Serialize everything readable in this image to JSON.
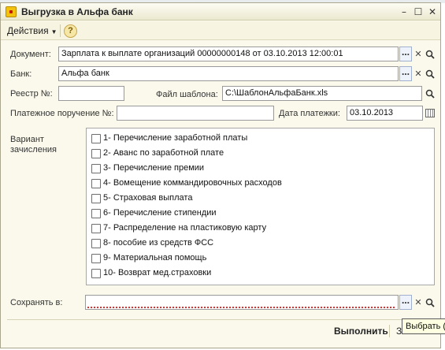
{
  "window": {
    "title": "Выгрузка в Альфа банк",
    "controls": {
      "minimize": "–",
      "maximize": "☐",
      "close": "✕"
    }
  },
  "toolbar": {
    "actions_label": "Действия",
    "help_label": "?"
  },
  "form": {
    "document": {
      "label": "Документ:",
      "value": "Зарплата к выплате организаций 00000000148 от 03.10.2013 12:00:01"
    },
    "bank": {
      "label": "Банк:",
      "value": "Альфа банк"
    },
    "registry": {
      "label": "Реестр №:",
      "value": ""
    },
    "template": {
      "label": "Файл шаблона:",
      "value": "C:\\ШаблонАльфаБанк.xls"
    },
    "payment_order": {
      "label": "Платежное поручение №:",
      "value": ""
    },
    "payment_date": {
      "label": "Дата платежки:",
      "value": "03.10.2013"
    },
    "variant": {
      "label_line1": "Вариант",
      "label_line2": "зачисления",
      "items": [
        {
          "label": "1- Перечисление заработной платы",
          "checked": false
        },
        {
          "label": "2- Аванс по заработной плате",
          "checked": false
        },
        {
          "label": "3- Перечисление премии",
          "checked": false
        },
        {
          "label": "4- Вомещение коммандировочных расходов",
          "checked": false
        },
        {
          "label": "5- Страховая выплата",
          "checked": false
        },
        {
          "label": "6- Перечисление стипендии",
          "checked": false
        },
        {
          "label": "7- Распределение на пластиковую карту",
          "checked": false
        },
        {
          "label": "8- пособие из средств ФСС",
          "checked": false
        },
        {
          "label": "9- Материальная помощь",
          "checked": false
        },
        {
          "label": "10- Возврат мед.страховки",
          "checked": false
        }
      ]
    },
    "save_to": {
      "label": "Сохранять в:",
      "value": ""
    }
  },
  "icons": {
    "select": "…",
    "clear": "✕",
    "search": "🔍",
    "calendar": "calendar-icon"
  },
  "buttons": {
    "run": "Выполнить",
    "close": "За"
  },
  "tooltip": "Выбрать (",
  "colors": {
    "window_bg": "#fbf9ec",
    "error_underline": "#e03030",
    "tooltip_bg": "#ffffe1"
  }
}
